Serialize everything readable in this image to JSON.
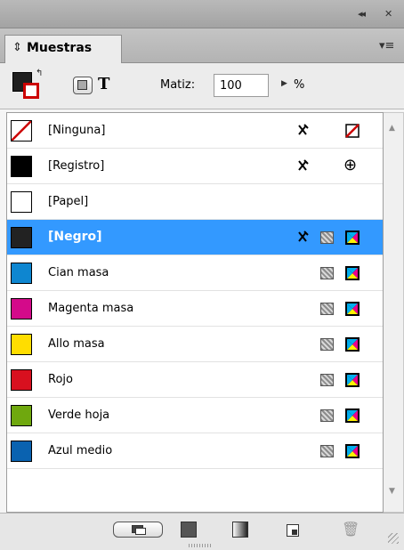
{
  "panel": {
    "tab_label": "Muestras",
    "tab_icon": "updown-chevrons-icon"
  },
  "toolbar": {
    "text_glyph": "T",
    "tint_label": "Matiz:",
    "tint_value": "100",
    "tint_unit": "%"
  },
  "swatches": [
    {
      "name": "[Ninguna]",
      "chip": "none",
      "color": "#ffffff",
      "non_editable": true,
      "mode": "none-icon",
      "selected": false
    },
    {
      "name": "[Registro]",
      "chip": "solid",
      "color": "#000000",
      "non_editable": true,
      "mode": "registration-icon",
      "selected": false
    },
    {
      "name": "[Papel]",
      "chip": "solid",
      "color": "#ffffff",
      "non_editable": false,
      "mode": "",
      "selected": false
    },
    {
      "name": "[Negro]",
      "chip": "solid",
      "color": "#222222",
      "non_editable": true,
      "mode": "cmyk-icon",
      "selected": true
    },
    {
      "name": "Cian masa",
      "chip": "solid",
      "color": "#0e86d0",
      "non_editable": false,
      "mode": "cmyk-icon",
      "selected": false
    },
    {
      "name": "Magenta masa",
      "chip": "solid",
      "color": "#d40a8a",
      "non_editable": false,
      "mode": "cmyk-icon",
      "selected": false
    },
    {
      "name": "Allo masa",
      "chip": "solid",
      "color": "#ffdd00",
      "non_editable": false,
      "mode": "cmyk-icon",
      "selected": false
    },
    {
      "name": "Rojo",
      "chip": "solid",
      "color": "#d8101f",
      "non_editable": false,
      "mode": "cmyk-icon",
      "selected": false
    },
    {
      "name": "Verde hoja",
      "chip": "solid",
      "color": "#6fa80e",
      "non_editable": false,
      "mode": "cmyk-icon",
      "selected": false
    },
    {
      "name": "Azul medio",
      "chip": "solid",
      "color": "#0a62b0",
      "non_editable": false,
      "mode": "cmyk-icon",
      "selected": false
    }
  ],
  "colors": {
    "selection": "#3399ff",
    "none_red": "#cc0000"
  }
}
